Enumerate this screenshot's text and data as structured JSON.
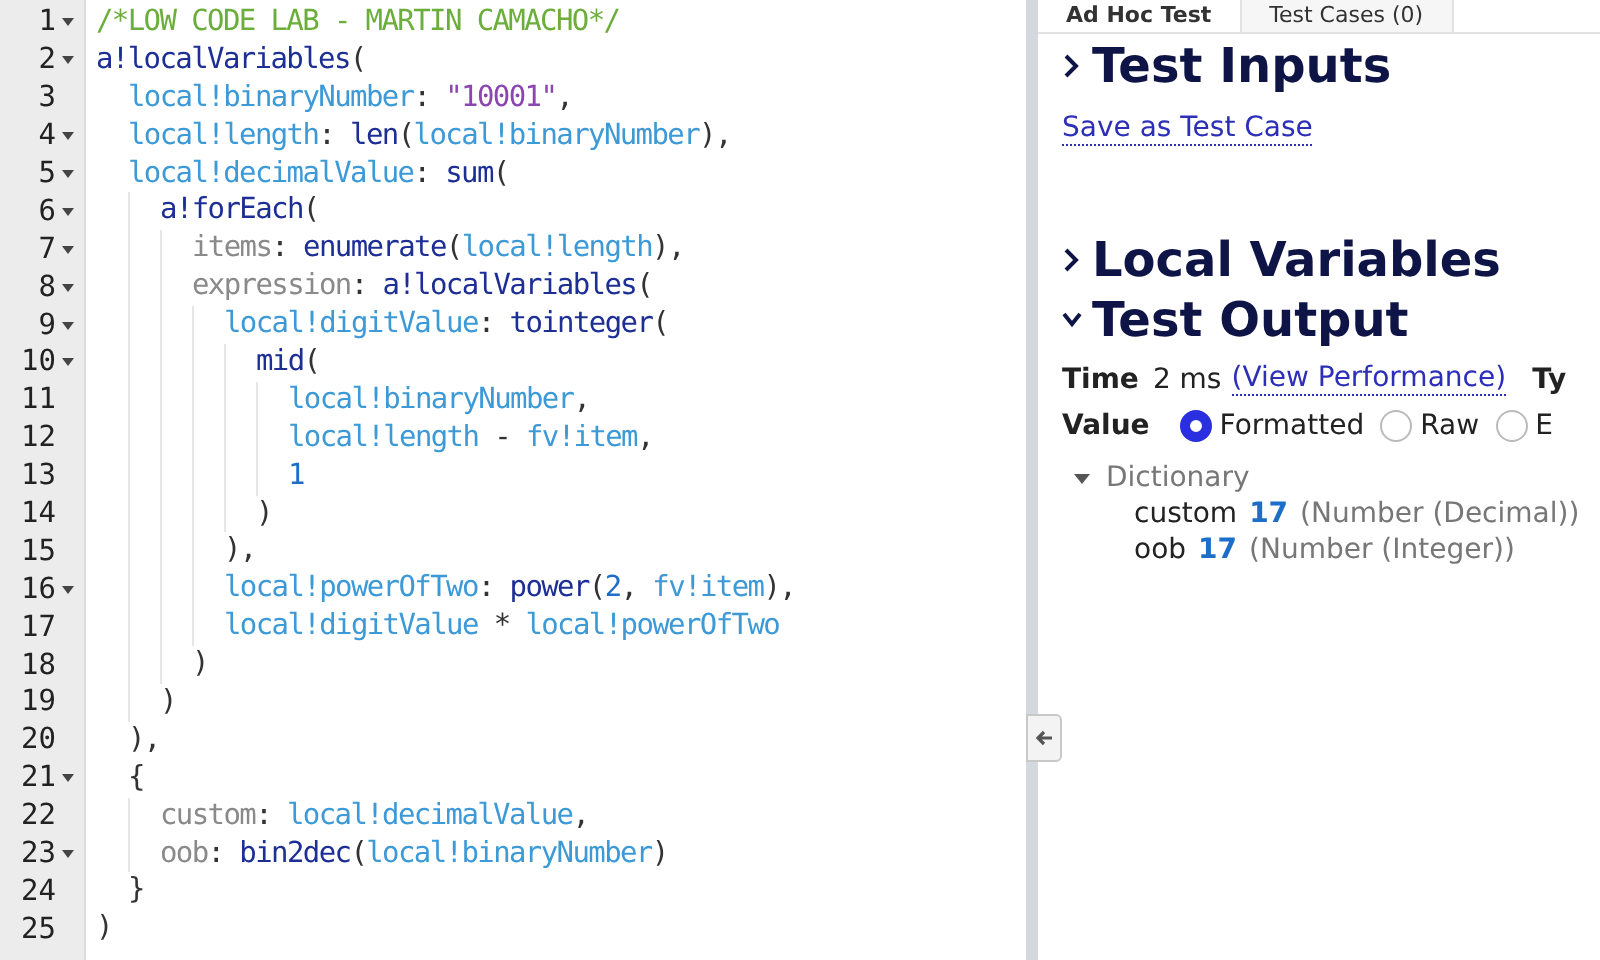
{
  "editor": {
    "lines": [
      {
        "number": "1",
        "foldable": true,
        "tokens": [
          {
            "kind": "comment",
            "text": "/*LOW CODE LAB - MARTIN CAMACHO*/"
          }
        ]
      },
      {
        "number": "2",
        "foldable": true,
        "tokens": [
          {
            "kind": "fn",
            "text": "a!localVariables"
          },
          {
            "kind": "punct",
            "text": "("
          }
        ],
        "children": [
          {
            "number": "3",
            "foldable": false,
            "tokens": [
              {
                "kind": "var",
                "text": "local!binaryNumber"
              },
              {
                "kind": "punct",
                "text": ": "
              },
              {
                "kind": "string",
                "text": "\"10001\""
              },
              {
                "kind": "punct",
                "text": ","
              }
            ]
          },
          {
            "number": "4",
            "foldable": true,
            "tokens": [
              {
                "kind": "var",
                "text": "local!length"
              },
              {
                "kind": "punct",
                "text": ": "
              },
              {
                "kind": "fn",
                "text": "len"
              },
              {
                "kind": "punct",
                "text": "("
              },
              {
                "kind": "var",
                "text": "local!binaryNumber"
              },
              {
                "kind": "punct",
                "text": "),"
              }
            ]
          },
          {
            "number": "5",
            "foldable": true,
            "tokens": [
              {
                "kind": "var",
                "text": "local!decimalValue"
              },
              {
                "kind": "punct",
                "text": ": "
              },
              {
                "kind": "fn",
                "text": "sum"
              },
              {
                "kind": "punct",
                "text": "("
              }
            ],
            "children": [
              {
                "number": "6",
                "foldable": true,
                "tokens": [
                  {
                    "kind": "fn",
                    "text": "a!forEach"
                  },
                  {
                    "kind": "punct",
                    "text": "("
                  }
                ],
                "children": [
                  {
                    "number": "7",
                    "foldable": true,
                    "tokens": [
                      {
                        "kind": "key",
                        "text": "items"
                      },
                      {
                        "kind": "punct",
                        "text": ": "
                      },
                      {
                        "kind": "fn",
                        "text": "enumerate"
                      },
                      {
                        "kind": "punct",
                        "text": "("
                      },
                      {
                        "kind": "var",
                        "text": "local!length"
                      },
                      {
                        "kind": "punct",
                        "text": "),"
                      }
                    ]
                  },
                  {
                    "number": "8",
                    "foldable": true,
                    "tokens": [
                      {
                        "kind": "key",
                        "text": "expression"
                      },
                      {
                        "kind": "punct",
                        "text": ": "
                      },
                      {
                        "kind": "fn",
                        "text": "a!localVariables"
                      },
                      {
                        "kind": "punct",
                        "text": "("
                      }
                    ],
                    "children": [
                      {
                        "number": "9",
                        "foldable": true,
                        "tokens": [
                          {
                            "kind": "var",
                            "text": "local!digitValue"
                          },
                          {
                            "kind": "punct",
                            "text": ": "
                          },
                          {
                            "kind": "fn",
                            "text": "tointeger"
                          },
                          {
                            "kind": "punct",
                            "text": "("
                          }
                        ],
                        "children": [
                          {
                            "number": "10",
                            "foldable": true,
                            "tokens": [
                              {
                                "kind": "fn",
                                "text": "mid"
                              },
                              {
                                "kind": "punct",
                                "text": "("
                              }
                            ],
                            "children": [
                              {
                                "number": "11",
                                "foldable": false,
                                "tokens": [
                                  {
                                    "kind": "var",
                                    "text": "local!binaryNumber"
                                  },
                                  {
                                    "kind": "punct",
                                    "text": ","
                                  }
                                ]
                              },
                              {
                                "number": "12",
                                "foldable": false,
                                "tokens": [
                                  {
                                    "kind": "var",
                                    "text": "local!length"
                                  },
                                  {
                                    "kind": "punct",
                                    "text": " - "
                                  },
                                  {
                                    "kind": "var",
                                    "text": "fv!item"
                                  },
                                  {
                                    "kind": "punct",
                                    "text": ","
                                  }
                                ]
                              },
                              {
                                "number": "13",
                                "foldable": false,
                                "tokens": [
                                  {
                                    "kind": "number",
                                    "text": "1"
                                  }
                                ]
                              }
                            ]
                          },
                          {
                            "number": "14",
                            "foldable": false,
                            "tokens": [
                              {
                                "kind": "punct",
                                "text": ")"
                              }
                            ]
                          }
                        ]
                      },
                      {
                        "number": "15",
                        "foldable": false,
                        "tokens": [
                          {
                            "kind": "punct",
                            "text": "),"
                          }
                        ]
                      },
                      {
                        "number": "16",
                        "foldable": true,
                        "tokens": [
                          {
                            "kind": "var",
                            "text": "local!powerOfTwo"
                          },
                          {
                            "kind": "punct",
                            "text": ": "
                          },
                          {
                            "kind": "fn",
                            "text": "power"
                          },
                          {
                            "kind": "punct",
                            "text": "("
                          },
                          {
                            "kind": "number",
                            "text": "2"
                          },
                          {
                            "kind": "punct",
                            "text": ", "
                          },
                          {
                            "kind": "var",
                            "text": "fv!item"
                          },
                          {
                            "kind": "punct",
                            "text": "),"
                          }
                        ]
                      },
                      {
                        "number": "17",
                        "foldable": false,
                        "tokens": [
                          {
                            "kind": "var",
                            "text": "local!digitValue"
                          },
                          {
                            "kind": "punct",
                            "text": " * "
                          },
                          {
                            "kind": "var",
                            "text": "local!powerOfTwo"
                          }
                        ]
                      }
                    ]
                  },
                  {
                    "number": "18",
                    "foldable": false,
                    "tokens": [
                      {
                        "kind": "punct",
                        "text": ")"
                      }
                    ]
                  }
                ]
              },
              {
                "number": "19",
                "foldable": false,
                "tokens": [
                  {
                    "kind": "punct",
                    "text": ")"
                  }
                ]
              }
            ]
          },
          {
            "number": "20",
            "foldable": false,
            "tokens": [
              {
                "kind": "punct",
                "text": "),"
              }
            ]
          },
          {
            "number": "21",
            "foldable": true,
            "tokens": [
              {
                "kind": "punct",
                "text": "{"
              }
            ],
            "children": [
              {
                "number": "22",
                "foldable": false,
                "tokens": [
                  {
                    "kind": "key",
                    "text": "custom"
                  },
                  {
                    "kind": "punct",
                    "text": ": "
                  },
                  {
                    "kind": "var",
                    "text": "local!decimalValue"
                  },
                  {
                    "kind": "punct",
                    "text": ","
                  }
                ]
              },
              {
                "number": "23",
                "foldable": true,
                "tokens": [
                  {
                    "kind": "key",
                    "text": "oob"
                  },
                  {
                    "kind": "punct",
                    "text": ": "
                  },
                  {
                    "kind": "fn",
                    "text": "bin2dec"
                  },
                  {
                    "kind": "punct",
                    "text": "("
                  },
                  {
                    "kind": "var",
                    "text": "local!binaryNumber"
                  },
                  {
                    "kind": "punct",
                    "text": ")"
                  }
                ]
              }
            ]
          },
          {
            "number": "24",
            "foldable": false,
            "tokens": [
              {
                "kind": "punct",
                "text": "}"
              }
            ]
          }
        ]
      },
      {
        "number": "25",
        "foldable": false,
        "tokens": [
          {
            "kind": "punct",
            "text": ")"
          }
        ]
      }
    ]
  },
  "tabs": [
    {
      "label": "Ad Hoc Test",
      "selected": true
    },
    {
      "label": "Test Cases (0)",
      "selected": false
    }
  ],
  "sections": [
    {
      "title": "Test Inputs",
      "expanded": false
    },
    {
      "title": "Local Variables",
      "expanded": false
    },
    {
      "title": "Test Output",
      "expanded": true
    }
  ],
  "save_link": "Save as Test Case",
  "output": {
    "time_label": "Time",
    "time_value": "2 ms",
    "performance_link": "(View Performance)",
    "type_label": "Ty",
    "value_label": "Value",
    "formats": [
      {
        "label": "Formatted",
        "selected": true
      },
      {
        "label": "Raw",
        "selected": false
      },
      {
        "label": "E",
        "selected": false
      }
    ],
    "tree": {
      "label": "Dictionary",
      "expanded": true,
      "children": [
        {
          "key": "custom",
          "value": "17",
          "type": "(Number (Decimal))"
        },
        {
          "key": "oob",
          "value": "17",
          "type": "(Number (Integer))"
        }
      ]
    }
  }
}
